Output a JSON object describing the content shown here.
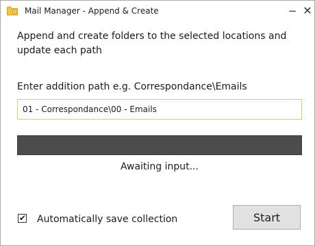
{
  "window": {
    "title": "Mail Manager - Append & Create",
    "minimize_glyph": "−",
    "close_glyph": "✕",
    "icon": "folder-icon"
  },
  "main": {
    "description": "Append and create folders to the selected locations and update each path",
    "path_label": "Enter addition path e.g. Correspondance\\Emails",
    "path_value": "01 - Correspondance\\00 - Emails",
    "progress_fraction": 0,
    "status": "Awaiting input..."
  },
  "footer": {
    "auto_save_label": "Automatically save collection",
    "auto_save_checked": true,
    "start_label": "Start"
  },
  "colors": {
    "input_focus_border": "#f2c55c",
    "progress_background": "#4c4c4c",
    "button_background": "#e1e1e1",
    "folder_icon": "#f4c242"
  }
}
